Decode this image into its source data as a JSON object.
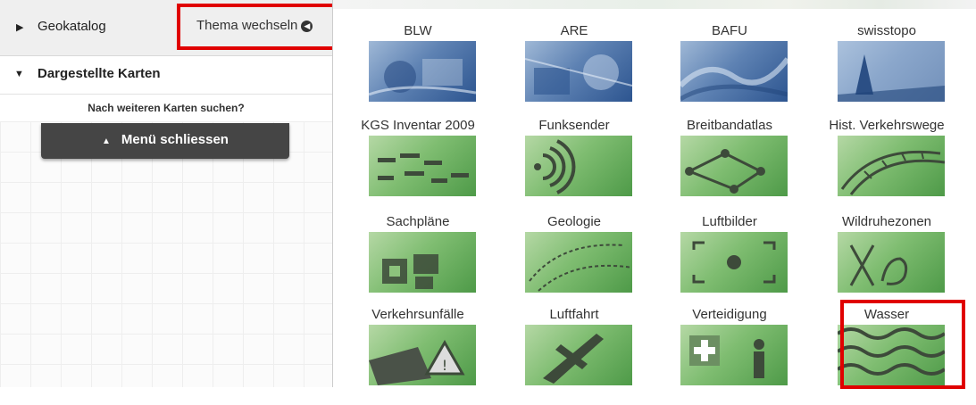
{
  "sidebar": {
    "geokatalog": "Geokatalog",
    "thema_wechseln": "Thema wechseln",
    "dargestellte_karten": "Dargestellte Karten",
    "search_more": "Nach weiteren Karten suchen?",
    "menu_close": "Menü schliessen"
  },
  "themes": [
    {
      "label": "BLW",
      "style": "blue"
    },
    {
      "label": "ARE",
      "style": "blue"
    },
    {
      "label": "BAFU",
      "style": "blue"
    },
    {
      "label": "swisstopo",
      "style": "blue"
    },
    {
      "label": "KGS Inventar 2009",
      "style": "green"
    },
    {
      "label": "Funksender",
      "style": "green"
    },
    {
      "label": "Breitbandatlas",
      "style": "green"
    },
    {
      "label": "Hist. Verkehrswege",
      "style": "green"
    },
    {
      "label": "Sachpläne",
      "style": "green"
    },
    {
      "label": "Geologie",
      "style": "green"
    },
    {
      "label": "Luftbilder",
      "style": "green"
    },
    {
      "label": "Wildruhezonen",
      "style": "green"
    },
    {
      "label": "Verkehrsunfälle",
      "style": "green"
    },
    {
      "label": "Luftfahrt",
      "style": "green"
    },
    {
      "label": "Verteidigung",
      "style": "green"
    },
    {
      "label": "Wasser",
      "style": "green"
    }
  ],
  "colors": {
    "highlight": "#e00000",
    "menu_button": "#454545"
  }
}
